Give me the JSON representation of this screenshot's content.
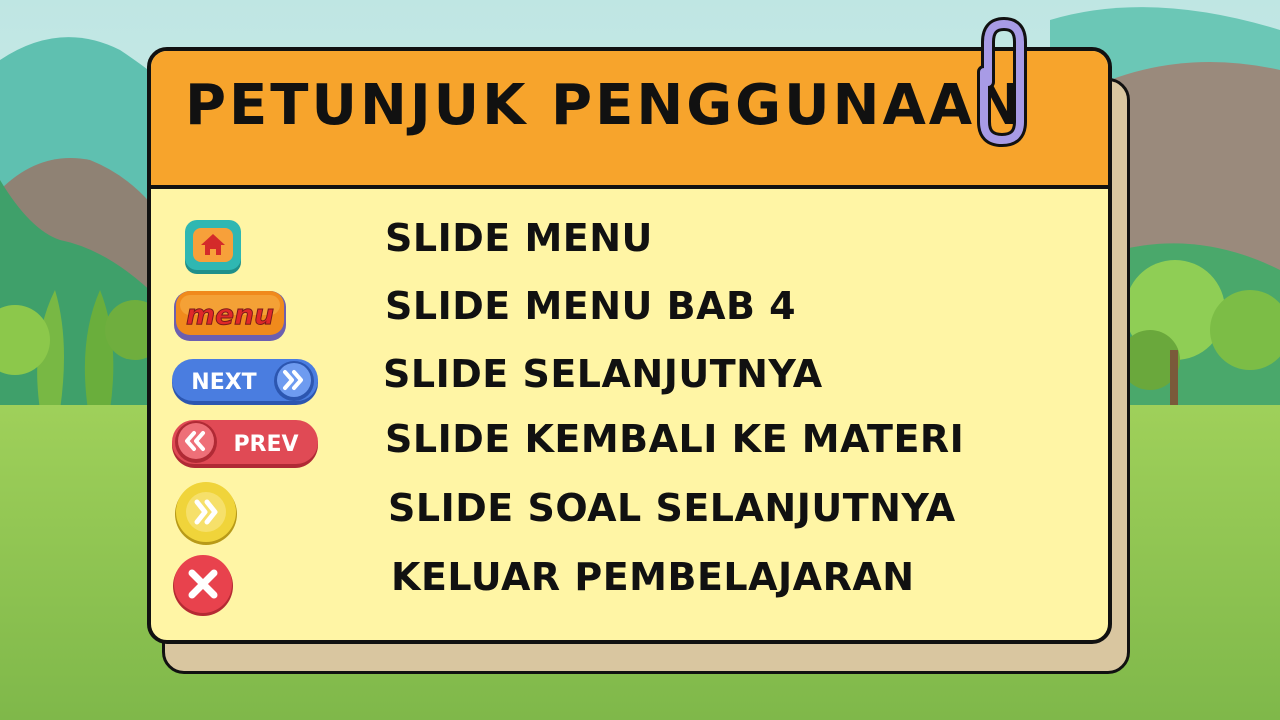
{
  "title": "PETUNJUK PENGGUNAAN",
  "buttons": {
    "menu_label": "menu",
    "next_label": "NEXT",
    "prev_label": "PREV"
  },
  "items": [
    {
      "icon": "home-icon",
      "label": "SLIDE MENU"
    },
    {
      "icon": "menu-badge",
      "label": "SLIDE MENU BAB 4"
    },
    {
      "icon": "next-button",
      "label": "SLIDE SELANJUTNYA"
    },
    {
      "icon": "prev-button",
      "label": "SLIDE KEMBALI KE MATERI"
    },
    {
      "icon": "double-chevron-icon",
      "label": "SLIDE SOAL SELANJUTNYA"
    },
    {
      "icon": "close-icon",
      "label": "KELUAR  PEMBELAJARAN"
    }
  ],
  "colors": {
    "header": "#f7a42c",
    "card": "#fff5a5",
    "card_back": "#d9c6a0",
    "next_blue": "#4a7de0",
    "prev_red": "#e04a55",
    "home_teal": "#2fb7b2",
    "menu_orange": "#f08a1c",
    "chevron_yellow": "#f0d43a",
    "close_red": "#e8424d"
  }
}
